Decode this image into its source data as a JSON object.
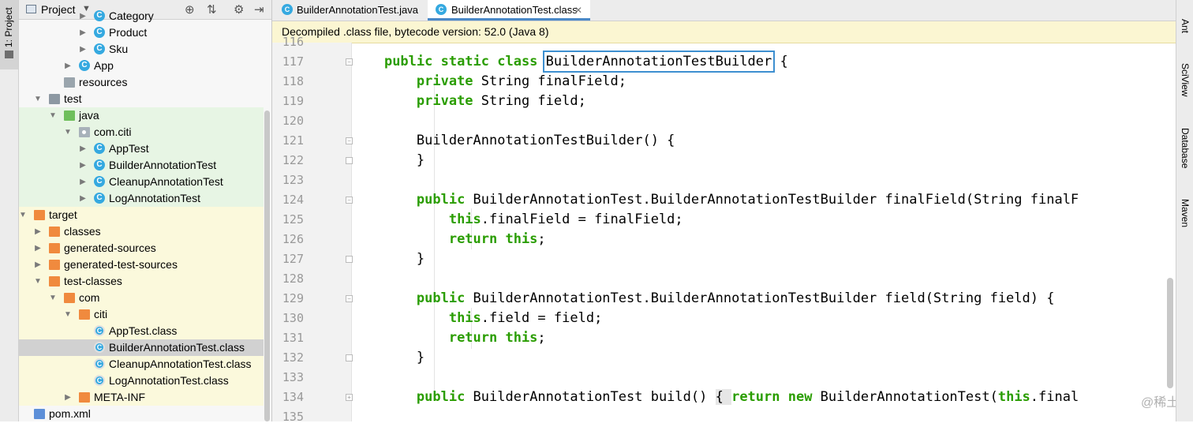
{
  "left_strip": {
    "project_tab": "1: Project"
  },
  "project_panel": {
    "title": "Project",
    "tree": [
      {
        "label": "Category",
        "icon": "class-icon",
        "depth": 6,
        "arrow": "collapsed",
        "bg": ""
      },
      {
        "label": "Product",
        "icon": "class-icon",
        "depth": 6,
        "arrow": "collapsed",
        "bg": ""
      },
      {
        "label": "Sku",
        "icon": "class-icon",
        "depth": 6,
        "arrow": "collapsed",
        "bg": ""
      },
      {
        "label": "App",
        "icon": "class-icon",
        "depth": 5,
        "arrow": "collapsed",
        "bg": ""
      },
      {
        "label": "resources",
        "icon": "resources-folder-icon",
        "depth": 4,
        "arrow": "none",
        "bg": ""
      },
      {
        "label": "test",
        "icon": "folder-icon",
        "depth": 3,
        "arrow": "expanded",
        "bg": ""
      },
      {
        "label": "java",
        "icon": "test-folder-icon",
        "depth": 4,
        "arrow": "expanded",
        "bg": "green"
      },
      {
        "label": "com.citi",
        "icon": "package-icon",
        "depth": 5,
        "arrow": "expanded",
        "bg": "green"
      },
      {
        "label": "AppTest",
        "icon": "class-icon",
        "depth": 6,
        "arrow": "collapsed",
        "bg": "green"
      },
      {
        "label": "BuilderAnnotationTest",
        "icon": "class-icon",
        "depth": 6,
        "arrow": "collapsed",
        "bg": "green"
      },
      {
        "label": "CleanupAnnotationTest",
        "icon": "class-icon",
        "depth": 6,
        "arrow": "collapsed",
        "bg": "green"
      },
      {
        "label": "LogAnnotationTest",
        "icon": "class-icon",
        "depth": 6,
        "arrow": "collapsed",
        "bg": "green"
      },
      {
        "label": "target",
        "icon": "excluded-folder-icon",
        "depth": 2,
        "arrow": "expanded",
        "bg": "yellow"
      },
      {
        "label": "classes",
        "icon": "excluded-folder-icon",
        "depth": 3,
        "arrow": "collapsed",
        "bg": "yellow"
      },
      {
        "label": "generated-sources",
        "icon": "excluded-folder-icon",
        "depth": 3,
        "arrow": "collapsed",
        "bg": "yellow"
      },
      {
        "label": "generated-test-sources",
        "icon": "excluded-folder-icon",
        "depth": 3,
        "arrow": "collapsed",
        "bg": "yellow"
      },
      {
        "label": "test-classes",
        "icon": "excluded-folder-icon",
        "depth": 3,
        "arrow": "expanded",
        "bg": "yellow"
      },
      {
        "label": "com",
        "icon": "excluded-folder-icon",
        "depth": 4,
        "arrow": "expanded",
        "bg": "yellow"
      },
      {
        "label": "citi",
        "icon": "excluded-folder-icon",
        "depth": 5,
        "arrow": "expanded",
        "bg": "yellow"
      },
      {
        "label": "AppTest.class",
        "icon": "class-file-icon",
        "depth": 6,
        "arrow": "none",
        "bg": "yellow"
      },
      {
        "label": "BuilderAnnotationTest.class",
        "icon": "class-file-icon",
        "depth": 6,
        "arrow": "none",
        "bg": "sel"
      },
      {
        "label": "CleanupAnnotationTest.class",
        "icon": "class-file-icon",
        "depth": 6,
        "arrow": "none",
        "bg": "yellow"
      },
      {
        "label": "LogAnnotationTest.class",
        "icon": "class-file-icon",
        "depth": 6,
        "arrow": "none",
        "bg": "yellow"
      },
      {
        "label": "META-INF",
        "icon": "excluded-folder-icon",
        "depth": 5,
        "arrow": "collapsed",
        "bg": "yellow"
      },
      {
        "label": "pom.xml",
        "icon": "maven-file-icon",
        "depth": 2,
        "arrow": "none",
        "bg": ""
      }
    ]
  },
  "tabs": [
    {
      "label": "BuilderAnnotationTest.java",
      "active": false
    },
    {
      "label": "BuilderAnnotationTest.class",
      "active": true
    }
  ],
  "banner": "Decompiled .class file, bytecode version: 52.0 (Java 8)",
  "editor": {
    "first_line_partial": "116",
    "lines": [
      {
        "n": "117",
        "tokens": [
          [
            "    ",
            ""
          ],
          [
            "public static class ",
            "kw"
          ],
          [
            "BuilderAnnotationTestBuilder",
            "box"
          ],
          [
            " {",
            ""
          ]
        ]
      },
      {
        "n": "118",
        "tokens": [
          [
            "        ",
            ""
          ],
          [
            "private ",
            "kw"
          ],
          [
            "String finalField;",
            ""
          ]
        ]
      },
      {
        "n": "119",
        "tokens": [
          [
            "        ",
            ""
          ],
          [
            "private ",
            "kw"
          ],
          [
            "String field;",
            ""
          ]
        ]
      },
      {
        "n": "120",
        "tokens": []
      },
      {
        "n": "121",
        "tokens": [
          [
            "        BuilderAnnotationTestBuilder() {",
            ""
          ]
        ]
      },
      {
        "n": "122",
        "tokens": [
          [
            "        }",
            ""
          ]
        ]
      },
      {
        "n": "123",
        "tokens": []
      },
      {
        "n": "124",
        "tokens": [
          [
            "        ",
            ""
          ],
          [
            "public ",
            "kw"
          ],
          [
            "BuilderAnnotationTest.BuilderAnnotationTestBuilder finalField(String finalF",
            ""
          ]
        ]
      },
      {
        "n": "125",
        "tokens": [
          [
            "            ",
            ""
          ],
          [
            "this",
            "kw"
          ],
          [
            ".finalField = finalField;",
            ""
          ]
        ]
      },
      {
        "n": "126",
        "tokens": [
          [
            "            ",
            ""
          ],
          [
            "return this",
            "kw"
          ],
          [
            ";",
            ""
          ]
        ]
      },
      {
        "n": "127",
        "tokens": [
          [
            "        }",
            ""
          ]
        ]
      },
      {
        "n": "128",
        "tokens": []
      },
      {
        "n": "129",
        "tokens": [
          [
            "        ",
            ""
          ],
          [
            "public ",
            "kw"
          ],
          [
            "BuilderAnnotationTest.BuilderAnnotationTestBuilder field(String field) {",
            ""
          ]
        ]
      },
      {
        "n": "130",
        "tokens": [
          [
            "            ",
            ""
          ],
          [
            "this",
            "kw"
          ],
          [
            ".field = field;",
            ""
          ]
        ]
      },
      {
        "n": "131",
        "tokens": [
          [
            "            ",
            ""
          ],
          [
            "return this",
            "kw"
          ],
          [
            ";",
            ""
          ]
        ]
      },
      {
        "n": "132",
        "tokens": [
          [
            "        }",
            ""
          ]
        ]
      },
      {
        "n": "133",
        "tokens": []
      },
      {
        "n": "134",
        "tokens": [
          [
            "        ",
            ""
          ],
          [
            "public ",
            "kw"
          ],
          [
            "BuilderAnnotationTest build() ",
            ""
          ],
          [
            "{ ",
            "brace"
          ],
          [
            "return new ",
            "kw"
          ],
          [
            "BuilderAnnotationTest(",
            ""
          ],
          [
            "this",
            "kw"
          ],
          [
            ".final",
            ""
          ]
        ]
      },
      {
        "n": "135",
        "tokens": []
      }
    ],
    "watermark": "@稀土掘金技术社区"
  },
  "right_strip": [
    "Ant",
    "SciView",
    "Database",
    "Maven"
  ],
  "colors": {
    "keyword": "#2a9d00",
    "accent": "#3d8fd0",
    "banner": "#fbf6d2"
  }
}
